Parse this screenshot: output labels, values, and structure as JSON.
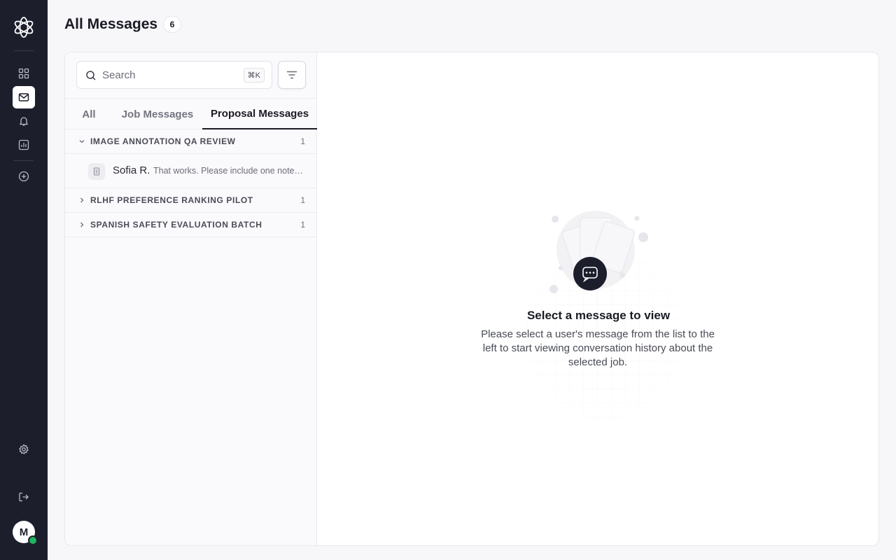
{
  "sidebar": {
    "logo_icon": "flower-logo-icon",
    "items": [
      {
        "name": "dashboard",
        "icon": "grid-icon",
        "active": false
      },
      {
        "name": "messages",
        "icon": "mail-icon",
        "active": true
      },
      {
        "name": "notifications",
        "icon": "bell-icon",
        "active": false
      },
      {
        "name": "analytics",
        "icon": "chart-icon",
        "active": false
      },
      {
        "name": "create",
        "icon": "plus-circle-icon",
        "active": false
      }
    ],
    "settings_icon": "gear-icon",
    "logout_icon": "logout-icon",
    "avatar_initial": "M",
    "online_color": "#22b35e"
  },
  "header": {
    "title": "All Messages",
    "count": "6"
  },
  "search": {
    "placeholder": "Search",
    "value": "",
    "shortcut": "⌘K"
  },
  "tabs": [
    {
      "label": "All",
      "active": false
    },
    {
      "label": "Job Messages",
      "active": false
    },
    {
      "label": "Proposal Messages",
      "active": true
    }
  ],
  "groups": [
    {
      "name": "IMAGE ANNOTATION QA REVIEW",
      "count": "1",
      "expanded": true,
      "messages": [
        {
          "sender": "Sofia R.",
          "preview": "That works. Please include one note about your review workflow."
        }
      ]
    },
    {
      "name": "RLHF PREFERENCE RANKING PILOT",
      "count": "1",
      "expanded": false
    },
    {
      "name": "SPANISH SAFETY EVALUATION BATCH",
      "count": "1",
      "expanded": false
    }
  ],
  "empty_state": {
    "icon": "chat-bubble-icon",
    "title": "Select a message to view",
    "description": "Please select a user's message from the list to the left to start viewing conversation history about the selected job."
  },
  "colors": {
    "sidebar_bg": "#1c1f2b",
    "accent": "#1a1c24"
  }
}
